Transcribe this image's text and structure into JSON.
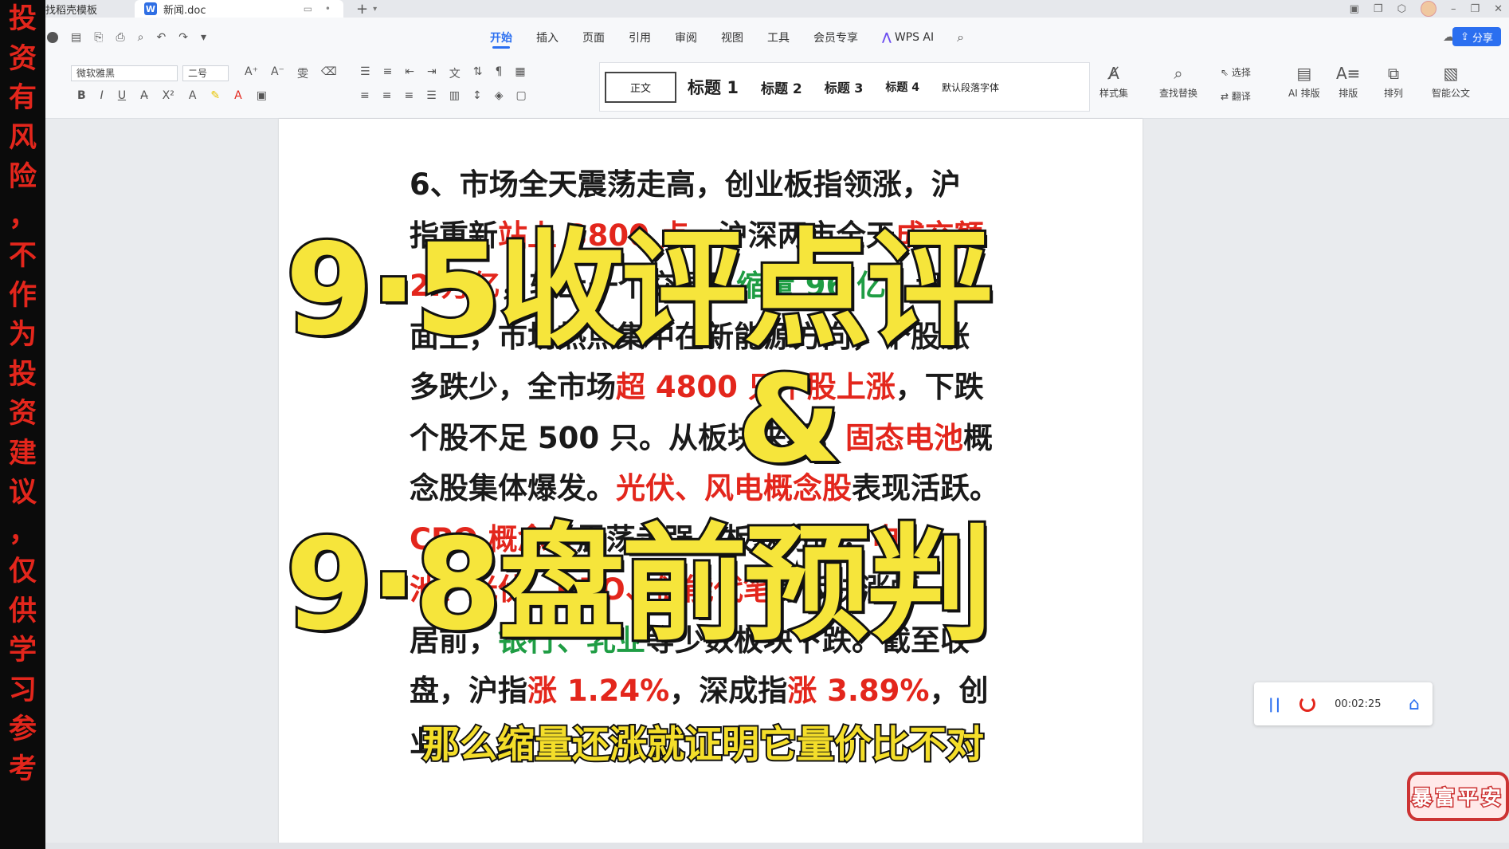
{
  "warning_strip": {
    "chars": [
      "投",
      "资",
      "有",
      "风",
      "险",
      "，",
      "不",
      "作",
      "为",
      "投",
      "资",
      "建",
      "议",
      "，",
      "仅",
      "供",
      "学",
      "习",
      "参",
      "考"
    ],
    "color": "#e3261c"
  },
  "tabs": {
    "find_template": "找稻壳模板",
    "doc_name": "新闻.doc",
    "doc_icon": "W"
  },
  "menu": {
    "items": [
      "开始",
      "插入",
      "页面",
      "引用",
      "审阅",
      "视图",
      "工具",
      "会员专享",
      "WPS AI"
    ],
    "active": "开始",
    "share": "分享"
  },
  "ribbon": {
    "font_name": "微软雅黑",
    "font_size": "二号",
    "styles": [
      "正文",
      "标题 1",
      "标题 2",
      "标题 3",
      "标题 4",
      "默认段落字体"
    ],
    "style_set": "样式集",
    "find_replace": "查找替换",
    "select": "选择",
    "translate": "翻译",
    "ai_layout": "AI 排版",
    "layout": "排版",
    "arrange": "排列",
    "smart_doc": "智能公文"
  },
  "document": {
    "lines": [
      [
        {
          "t": "6、市场全天震荡走高，创业板指领涨，沪",
          "c": ""
        }
      ],
      [
        {
          "t": "指重新",
          "c": ""
        },
        {
          "t": "站上 3800 点",
          "c": "red"
        },
        {
          "t": "，沪深两市全天",
          "c": ""
        },
        {
          "t": "成交额",
          "c": "red"
        }
      ],
      [
        {
          "t": "2.",
          "c": "red"
        },
        {
          "t": "万亿",
          "c": "red"
        },
        {
          "t": "，较上一个交易日",
          "c": ""
        },
        {
          "t": "缩量 96 亿",
          "c": "green"
        },
        {
          "t": "。盘",
          "c": ""
        }
      ],
      [
        {
          "t": "面上，市场热点集中在新能源方向，个股涨",
          "c": ""
        }
      ],
      [
        {
          "t": "多跌少，全市场",
          "c": ""
        },
        {
          "t": "超 4800 只个股上涨",
          "c": "red"
        },
        {
          "t": "，下跌",
          "c": ""
        }
      ],
      [
        {
          "t": "个股不足 500 只。从板块来看，",
          "c": ""
        },
        {
          "t": "固态电池",
          "c": "red"
        },
        {
          "t": "概",
          "c": ""
        }
      ],
      [
        {
          "t": "念股集体爆发。",
          "c": ""
        },
        {
          "t": "光伏、风电概念股",
          "c": "red"
        },
        {
          "t": "表现活跃。",
          "c": ""
        }
      ],
      [
        {
          "t": "CPO 概念股",
          "c": "red"
        },
        {
          "t": "震荡走强。板块方面，",
          "c": ""
        },
        {
          "t": "电",
          "c": "red"
        }
      ],
      [
        {
          "t": "池、光伏、CPO、储能代笔",
          "c": "red"
        },
        {
          "t": "等板块涨幅",
          "c": ""
        }
      ],
      [
        {
          "t": "居前，",
          "c": ""
        },
        {
          "t": "银行、乳业",
          "c": "green"
        },
        {
          "t": "等少数板块下跌。截至收",
          "c": ""
        }
      ],
      [
        {
          "t": "盘，沪指",
          "c": ""
        },
        {
          "t": "涨 1.24%",
          "c": "red"
        },
        {
          "t": "，深成指",
          "c": ""
        },
        {
          "t": "涨 3.89%",
          "c": "red"
        },
        {
          "t": "，创",
          "c": ""
        }
      ],
      [
        {
          "t": "业",
          "c": ""
        }
      ]
    ]
  },
  "overlay": {
    "title1": "9·5收评点评",
    "amp": "&",
    "title2": "9·8盘前预判",
    "subtitle": "那么缩量还涨就证明它量价比不对"
  },
  "recorder": {
    "time": "00:02:25"
  },
  "sticker": {
    "text": "暴富平安"
  }
}
